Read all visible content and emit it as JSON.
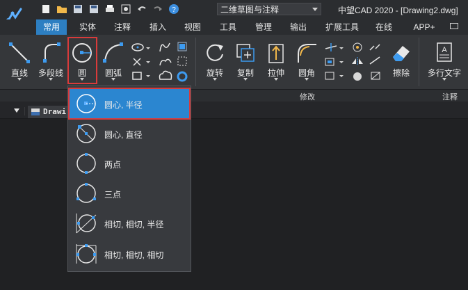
{
  "workspace": "二维草图与注释",
  "app_title": "中望CAD 2020 - [Drawing2.dwg]",
  "tabs": [
    "常用",
    "实体",
    "注释",
    "插入",
    "视图",
    "工具",
    "管理",
    "输出",
    "扩展工具",
    "在线",
    "APP+"
  ],
  "draw_panel": {
    "line": "直线",
    "polyline": "多段线",
    "circle": "圆",
    "arc": "圆弧"
  },
  "modify_panel": {
    "rotate": "旋转",
    "copy": "复制",
    "stretch": "拉伸",
    "fillet": "圆角",
    "erase": "擦除"
  },
  "annotate_panel": {
    "mtext": "多行文字"
  },
  "panel_labels": {
    "modify": "修改",
    "annotate": "注释"
  },
  "file_tab": "Drawi",
  "circle_menu": [
    {
      "label": "圆心, 半径",
      "selected": true
    },
    {
      "label": "圆心, 直径",
      "selected": false
    },
    {
      "label": "两点",
      "selected": false
    },
    {
      "label": "三点",
      "selected": false
    },
    {
      "label": "相切, 相切, 半径",
      "selected": false
    },
    {
      "label": "相切, 相切, 相切",
      "selected": false
    }
  ],
  "colors": {
    "accent": "#2b86d0",
    "highlight_border": "#d93b3b"
  }
}
